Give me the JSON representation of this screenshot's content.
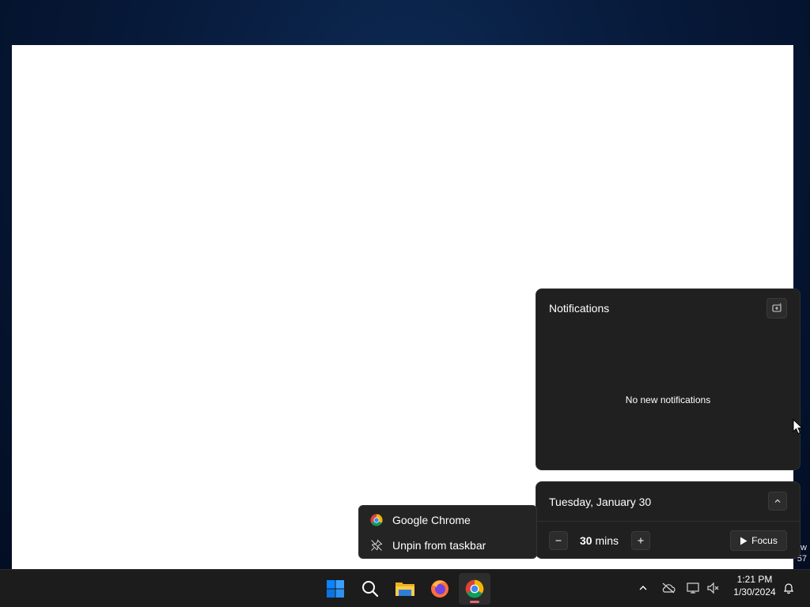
{
  "desktop": {
    "edge_text_1": "w",
    "edge_text_2": "57"
  },
  "notifications": {
    "title": "Notifications",
    "empty_message": "No new notifications",
    "settings_icon": "notification-settings-icon"
  },
  "calendar": {
    "date": "Tuesday, January 30",
    "focus_minutes": "30",
    "minutes_unit": "mins",
    "focus_label": "Focus"
  },
  "jump_list": {
    "app_name": "Google Chrome",
    "unpin_label": "Unpin from taskbar"
  },
  "taskbar": {
    "apps": [
      "start",
      "search",
      "file-explorer",
      "firefox",
      "google-chrome"
    ],
    "clock_time": "1:21 PM",
    "clock_date": "1/30/2024"
  },
  "colors": {
    "panel_bg": "#202020",
    "taskbar_bg": "#1c1c1c",
    "accent_blue": "#0a84ff"
  }
}
